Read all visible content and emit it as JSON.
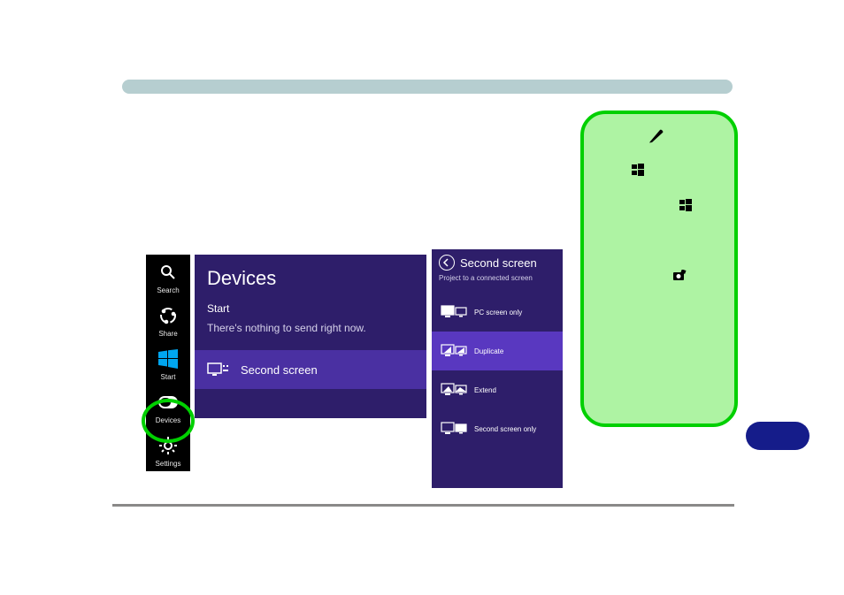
{
  "charms": {
    "search": "Search",
    "share": "Share",
    "start": "Start",
    "devices": "Devices",
    "settings": "Settings"
  },
  "devices_panel": {
    "title": "Devices",
    "start_label": "Start",
    "empty_msg": "There's nothing to send right now.",
    "second_screen_label": "Second screen"
  },
  "second_screen": {
    "title": "Second screen",
    "subtitle": "Project to a connected screen",
    "options": {
      "pc_only": "PC screen only",
      "duplicate": "Duplicate",
      "extend": "Extend",
      "second_only": "Second screen only"
    },
    "selected_index": 1
  },
  "colors": {
    "panel_bg": "#2e1e6a",
    "panel_accent": "#5938c0",
    "highlight_green": "#aef3a3",
    "highlight_border": "#00d000"
  }
}
